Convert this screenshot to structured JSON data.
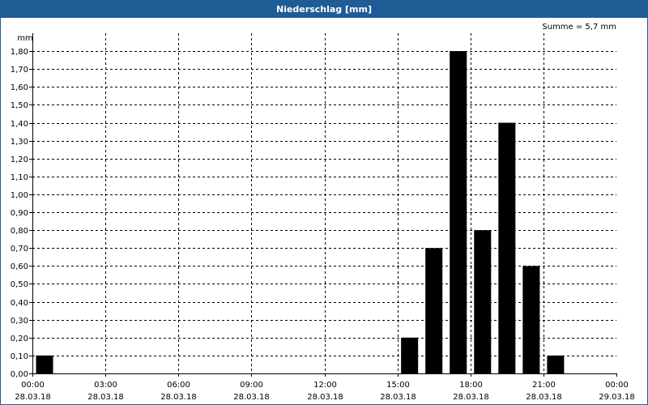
{
  "window": {
    "title": "Niederschlag [mm]"
  },
  "chart_data": {
    "type": "bar",
    "title": "Niederschlag [mm]",
    "ylabel": "mm",
    "annotation": "Summe = 5,7 mm",
    "ylim": [
      0,
      1.9
    ],
    "yticks": [
      "0,00",
      "0,10",
      "0,20",
      "0,30",
      "0,40",
      "0,50",
      "0,60",
      "0,70",
      "0,80",
      "0,90",
      "1,00",
      "1,10",
      "1,20",
      "1,30",
      "1,40",
      "1,50",
      "1,60",
      "1,70",
      "1,80"
    ],
    "xlim_hours": [
      0,
      24
    ],
    "xticks": [
      {
        "time": "00:00",
        "date": "28.03.18"
      },
      {
        "time": "03:00",
        "date": "28.03.18"
      },
      {
        "time": "06:00",
        "date": "28.03.18"
      },
      {
        "time": "09:00",
        "date": "28.03.18"
      },
      {
        "time": "12:00",
        "date": "28.03.18"
      },
      {
        "time": "15:00",
        "date": "28.03.18"
      },
      {
        "time": "18:00",
        "date": "28.03.18"
      },
      {
        "time": "21:00",
        "date": "28.03.18"
      },
      {
        "time": "00:00",
        "date": "29.03.18"
      }
    ],
    "bars": [
      {
        "start": "00:00",
        "value": 0.1
      },
      {
        "start": "15:00",
        "value": 0.2
      },
      {
        "start": "16:00",
        "value": 0.7
      },
      {
        "start": "17:00",
        "value": 1.8
      },
      {
        "start": "18:00",
        "value": 0.8
      },
      {
        "start": "19:00",
        "value": 1.4
      },
      {
        "start": "20:00",
        "value": 0.6
      },
      {
        "start": "21:00",
        "value": 0.1
      }
    ],
    "grid": true,
    "bar_color": "#000000"
  }
}
